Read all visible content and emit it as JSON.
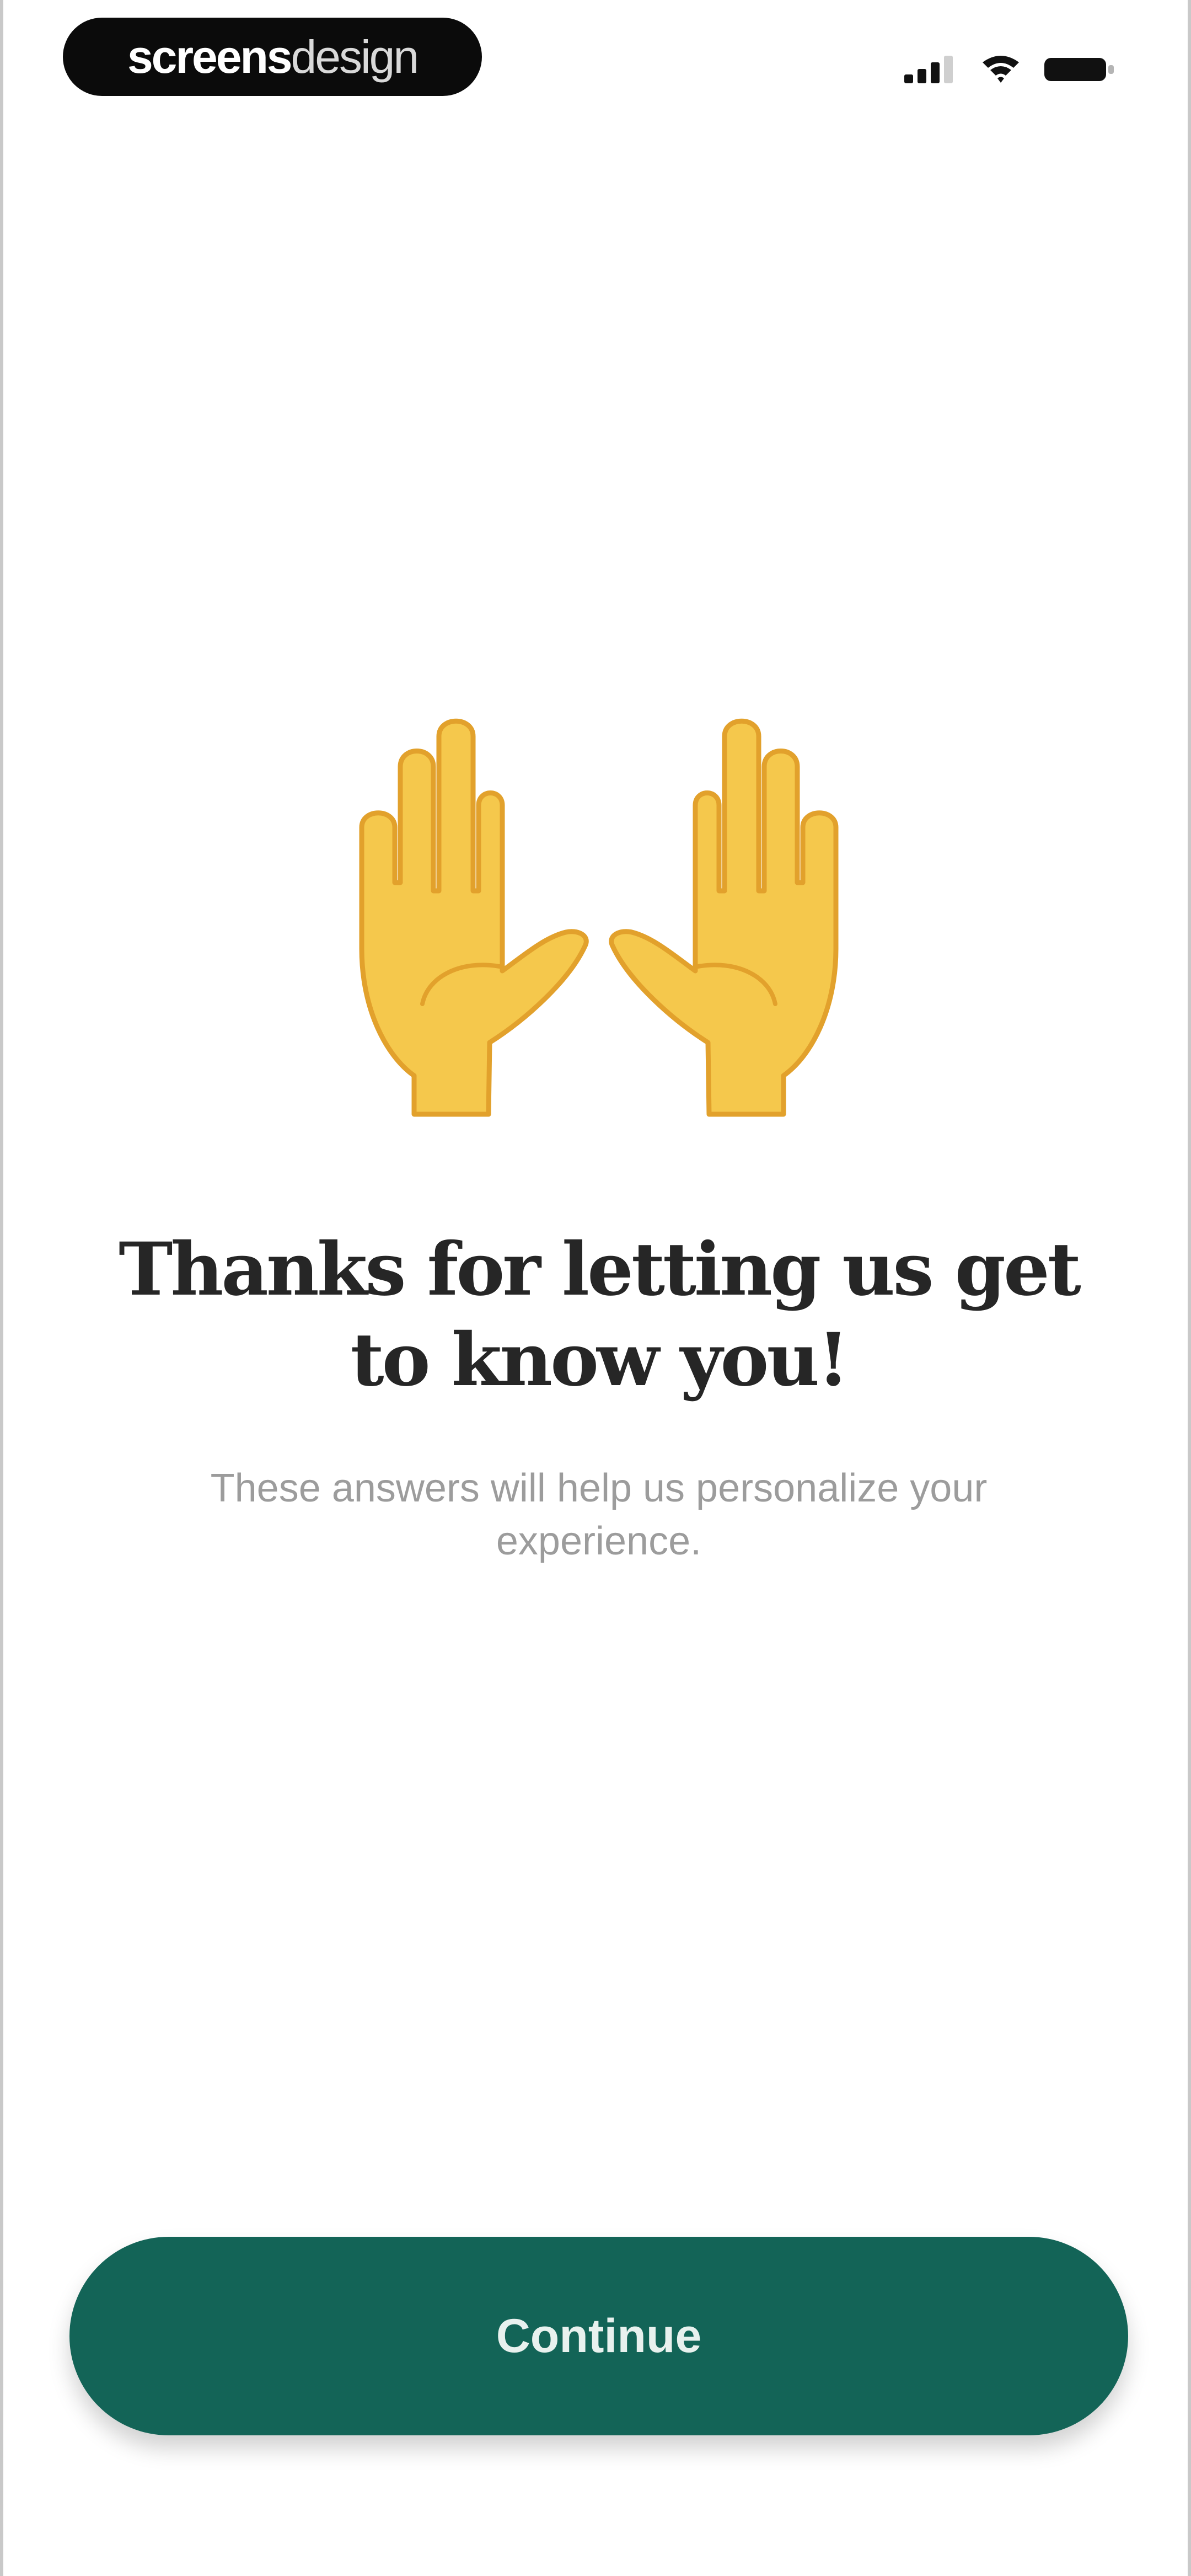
{
  "status_bar": {
    "brand_bold": "screens",
    "brand_light": "design",
    "icons": [
      "signal-icon",
      "wifi-icon",
      "battery-icon"
    ]
  },
  "hero": {
    "icon": "raised-hands-icon"
  },
  "content": {
    "headline": "Thanks for letting us get to know you!",
    "subtext": "These answers will help us personalize your experience."
  },
  "actions": {
    "continue_label": "Continue"
  },
  "colors": {
    "primary": "#136457",
    "headline": "#262626",
    "subtext": "#9c9c9c",
    "hands": "#F5C84C"
  }
}
